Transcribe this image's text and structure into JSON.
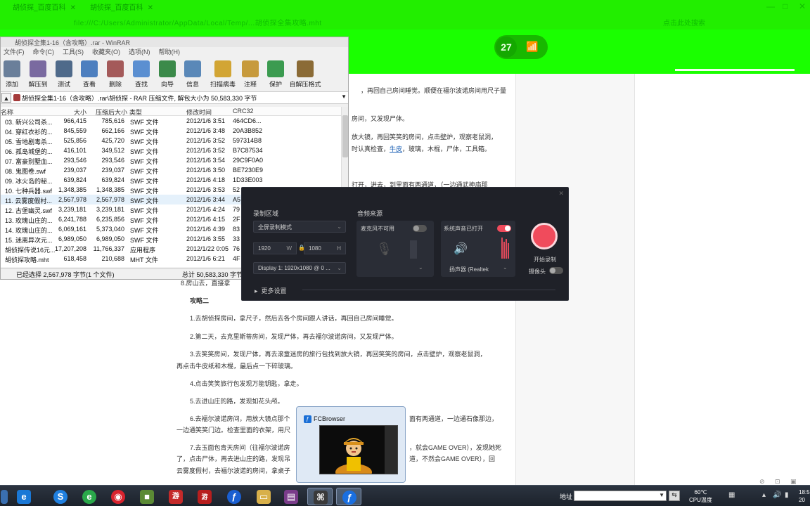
{
  "browser": {
    "tabs": [
      {
        "label": "胡侦探_百度百科"
      },
      {
        "label": "胡侦探_百度百科"
      }
    ],
    "url": "file:///C:/Users/Administrator/AppData/Local/Temp/...胡侦探全集攻略.mht",
    "search_placeholder": "点击此处搜索",
    "speed_badge": "27",
    "window_controls": [
      "—",
      "□",
      "✕"
    ]
  },
  "article": {
    "lines": [
      {
        "text": "，再回自己房间睡觉。顺便在福尔波诺房间用尺子量",
        "bold": false
      },
      {
        "text": "房间，又发现尸体。",
        "bold": false
      },
      {
        "text": "放大镜，再回笑笑的房间，点击壁炉，观察老鼠洞，",
        "bold": false
      },
      {
        "text": "时认真检查，",
        "bold": false,
        "link": "牛皮",
        "after": "，玻璃，木棍，尸体，工具箱。"
      },
      {
        "text": "打开，进去，到里面有两通道，（一边通武神庙那",
        "bold": false
      },
      {
        "text": "攻略二",
        "bold": true
      },
      {
        "text": "1.去胡侦探房间，拿尺子，然后去各个房间跟人讲话，再回自己房间睡觉。",
        "bold": false
      },
      {
        "text": "2.第二天，去克里斯蒂房间，发现尸体，再去福尔波诺房间，又发现尸体。",
        "bold": false
      },
      {
        "text": "3.去笑笑房间，发现尸体，再去滚童迷房的旅行包找到放大镜，再回笑笑的房间，点击壁炉，观察老鼠洞，",
        "bold": false
      },
      {
        "text": "再点击牛皮纸和木棍，最后点一下碎玻璃。",
        "bold": false
      },
      {
        "text": "4.点击笑笑旅行包发现万能钥匙，拿走。",
        "bold": false
      },
      {
        "text": "5.去进山庄的路，发现如花头颅。",
        "bold": false
      },
      {
        "text": "6.去福尔波诺房间，用放大镜点那个",
        "bold": false
      },
      {
        "text": "一边通笑笑门边。检查里面的衣架，用尺",
        "bold": false
      },
      {
        "text": "7.去玉面包青天房间（往福尔波诺房",
        "bold": false
      },
      {
        "text": "了，点击尸体，再去进山庄的路，发现吊",
        "bold": false
      },
      {
        "text": "云雾度假村，去福尔波诺的房间，拿桌子",
        "bold": false
      },
      {
        "text": "面有两通道，一边通石像那边，",
        "bold": false
      },
      {
        "text": "，就会GAME OVER），发现她死",
        "bold": false
      },
      {
        "text": "道，不然会GAME OVER），回",
        "bold": false
      },
      {
        "text": "8.房山去，直接拿",
        "bold": false
      }
    ]
  },
  "winrar": {
    "title": "胡侦探全集1-16（含攻略）.rar - WinRAR",
    "menu": [
      "文件(F)",
      "命令(C)",
      "工具(S)",
      "收藏夹(O)",
      "选项(N)",
      "帮助(H)"
    ],
    "toolbar": [
      {
        "label": "添加",
        "icon": "add-icon",
        "color": "#6a7f9a"
      },
      {
        "label": "解压到",
        "icon": "extract-icon",
        "color": "#7a6aa0"
      },
      {
        "label": "测试",
        "icon": "test-icon",
        "color": "#4f6a8a"
      },
      {
        "label": "查看",
        "icon": "view-icon",
        "color": "#4d7fbf"
      },
      {
        "label": "删除",
        "icon": "delete-icon",
        "color": "#a45a5a"
      },
      {
        "label": "查找",
        "icon": "find-icon",
        "color": "#5b8fd1"
      },
      {
        "label": "向导",
        "icon": "wizard-icon",
        "color": "#3b8a4a"
      },
      {
        "label": "信息",
        "icon": "info-icon",
        "color": "#5a88b8"
      },
      {
        "label": "扫描病毒",
        "icon": "scan-icon",
        "color": "#d2a534"
      },
      {
        "label": "注释",
        "icon": "comment-icon",
        "color": "#c79a3c"
      },
      {
        "label": "保护",
        "icon": "protect-icon",
        "color": "#3b9b50"
      },
      {
        "label": "自解压格式",
        "icon": "sfx-icon",
        "color": "#8b6b36"
      }
    ],
    "path": "胡侦探全集1-16（含攻略）.rar\\胡侦探 - RAR 压缩文件, 解包大小为 50,583,330 字节",
    "columns": [
      "名称",
      "大小",
      "压缩后大小",
      "类型",
      "修改时间",
      "CRC32"
    ],
    "rows": [
      [
        "03. 新兴公司杀...",
        "966,415",
        "785,616",
        "SWF 文件",
        "2012/1/6 3:51",
        "464CD6..."
      ],
      [
        "04. 穿红衣衫的...",
        "845,559",
        "662,166",
        "SWF 文件",
        "2012/1/6 3:48",
        "20A3B852"
      ],
      [
        "05. 雪地剧毒杀...",
        "525,856",
        "425,720",
        "SWF 文件",
        "2012/1/6 3:52",
        "597314B8"
      ],
      [
        "06. 孤岛城堡的...",
        "416,101",
        "349,512",
        "SWF 文件",
        "2012/1/6 3:52",
        "B7C87534"
      ],
      [
        "07. 富豪别墅血...",
        "293,546",
        "293,546",
        "SWF 文件",
        "2012/1/6 3:54",
        "29C9F0A0"
      ],
      [
        "08. 鬼图卷.swf",
        "239,037",
        "239,037",
        "SWF 文件",
        "2012/1/6 3:50",
        "BE7230E9"
      ],
      [
        "09. 冰火岛的秘...",
        "639,824",
        "639,824",
        "SWF 文件",
        "2012/1/6 4:18",
        "1D33E003"
      ],
      [
        "10. 七种兵器.swf",
        "1,348,385",
        "1,348,385",
        "SWF 文件",
        "2012/1/6 3:53",
        "52"
      ],
      [
        "11. 云雾度假村...",
        "2,567,978",
        "2,567,978",
        "SWF 文件",
        "2012/1/6 3:44",
        "A5"
      ],
      [
        "12. 古堡幽灵.swf",
        "3,239,181",
        "3,239,181",
        "SWF 文件",
        "2012/1/6 4:24",
        "79"
      ],
      [
        "13. 玫瑰山庄的...",
        "6,241,788",
        "6,235,856",
        "SWF 文件",
        "2012/1/6 4:15",
        "2F"
      ],
      [
        "14. 玫瑰山庄的...",
        "6,069,161",
        "5,373,040",
        "SWF 文件",
        "2012/1/6 4:39",
        "83"
      ],
      [
        "15. 迷离异次元...",
        "6,989,050",
        "6,989,050",
        "SWF 文件",
        "2012/1/6 3:55",
        "33"
      ],
      [
        "胡侦探传说16元...",
        "17,207,208",
        "11,766,337",
        "应用程序",
        "2012/1/22 0:05",
        "76"
      ],
      [
        "胡侦探攻略.mht",
        "618,458",
        "210,688",
        "MHT 文件",
        "2012/1/6 6:21",
        "4F"
      ]
    ],
    "status_left": "已经选择 2,567,978 字节(1 个文件)",
    "status_right": "总计 50,583,330 字节(1"
  },
  "recorder": {
    "area_title": "录制区域",
    "audio_title": "音频来源",
    "mode": "全屏录制模式",
    "width": "1920",
    "height": "1080",
    "w_unit": "W",
    "h_unit": "H",
    "display": "Display 1: 1920x1080 @ 0 ...",
    "mic_label": "麦克风不可用",
    "sys_label": "系统声音已打开",
    "speaker": "扬声器 (Realtek",
    "start_label": "开始录制",
    "camera_label": "摄像头",
    "more_label": "更多设置",
    "accent": "#f04b5c"
  },
  "thumbnail": {
    "title": "FCBrowser"
  },
  "taskbar": {
    "apps": [
      {
        "name": "windows-logo",
        "glyph": "",
        "color": "transparent"
      },
      {
        "name": "ie-icon",
        "glyph": "e",
        "color": "#1a78d6"
      },
      {
        "name": "sogou-icon",
        "glyph": "S",
        "color": "#2080e0"
      },
      {
        "name": "browser-360-icon",
        "glyph": "e",
        "color": "#2aa84a"
      },
      {
        "name": "netease-music-icon",
        "glyph": "◉",
        "color": "#d9232e"
      },
      {
        "name": "minecraft-icon",
        "glyph": "■",
        "color": "#5b8a35"
      },
      {
        "name": "game-icon",
        "glyph": "游",
        "color": "#c42a2a"
      },
      {
        "name": "flash-icon",
        "glyph": "ƒ",
        "color": "#1a5fd1"
      },
      {
        "name": "explorer-icon",
        "glyph": "▭",
        "color": "#d8b04a"
      },
      {
        "name": "winrar-icon",
        "glyph": "▤",
        "color": "#7a3c8a"
      },
      {
        "name": "gamepad-icon",
        "glyph": "⌘",
        "color": "#3a3a3a"
      },
      {
        "name": "fcbrowser-icon",
        "glyph": "ƒ",
        "color": "#1a6fe0"
      }
    ],
    "address_label": "地址",
    "temp": "60℃",
    "temp_label": "CPU温度",
    "time": "18:5",
    "date": "20"
  }
}
